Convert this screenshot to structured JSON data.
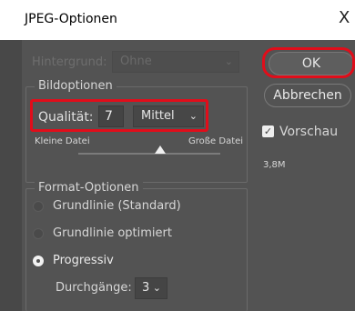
{
  "window": {
    "title": "JPEG-Optionen",
    "close_glyph": "X"
  },
  "background": {
    "label": "Hintergrund:",
    "value": "Ohne"
  },
  "image_options": {
    "group_title": "Bildoptionen",
    "quality_label": "Qualität:",
    "quality_value": "7",
    "quality_preset": "Mittel",
    "slider_left_label": "Kleine Datei",
    "slider_right_label": "Große Datei",
    "slider_level": 0.58
  },
  "format_options": {
    "group_title": "Format-Optionen",
    "options": [
      {
        "label": "Grundlinie (Standard)",
        "selected": false
      },
      {
        "label": "Grundlinie optimiert",
        "selected": false
      },
      {
        "label": "Progressiv",
        "selected": true
      }
    ],
    "scans_label": "Durchgänge:",
    "scans_value": "3"
  },
  "buttons": {
    "ok": "OK",
    "cancel": "Abbrechen"
  },
  "preview": {
    "label": "Vorschau",
    "checked": true,
    "file_size": "3,8M"
  },
  "colors": {
    "highlight": "#e10d1a",
    "dialog_bg": "#535353"
  }
}
